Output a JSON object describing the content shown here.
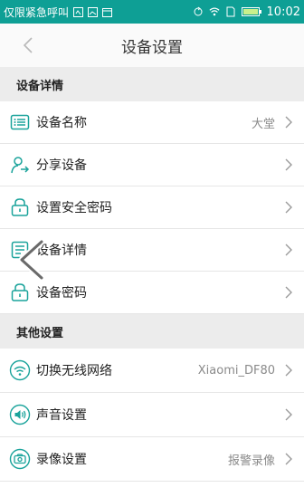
{
  "status_bar": {
    "carrier_text": "仅限紧急呼叫",
    "time": "10:02",
    "colors": {
      "background": "#0e9f95"
    }
  },
  "nav": {
    "title": "设备设置",
    "back_icon": "chevron-left-icon"
  },
  "sections": [
    {
      "title": "设备详情",
      "items": [
        {
          "label": "设备名称",
          "value": "大堂",
          "icon": "list-icon"
        },
        {
          "label": "分享设备",
          "value": "",
          "icon": "person-share-icon"
        },
        {
          "label": "设置安全密码",
          "value": "",
          "icon": "lock-icon"
        },
        {
          "label": "设备详情",
          "value": "",
          "icon": "document-icon"
        },
        {
          "label": "设备密码",
          "value": "",
          "icon": "lock-icon"
        }
      ]
    },
    {
      "title": "其他设置",
      "items": [
        {
          "label": "切换无线网络",
          "value": "Xiaomi_DF80",
          "icon": "wifi-icon"
        },
        {
          "label": "声音设置",
          "value": "",
          "icon": "speaker-icon"
        },
        {
          "label": "录像设置",
          "value": "报警录像",
          "icon": "camera-icon"
        }
      ]
    }
  ],
  "accent_color": "#1aa39b"
}
